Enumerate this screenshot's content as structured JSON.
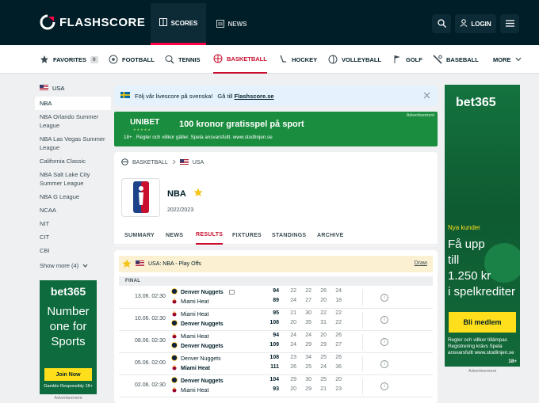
{
  "header": {
    "logo_text": "FLASHSCORE",
    "nav": [
      {
        "label": "SCORES"
      },
      {
        "label": "NEWS"
      }
    ],
    "login_label": "LOGIN"
  },
  "sports": [
    {
      "label": "FAVORITES",
      "count": "0",
      "icon": "star-icon"
    },
    {
      "label": "FOOTBALL",
      "icon": "football-icon"
    },
    {
      "label": "TENNIS",
      "icon": "tennis-icon"
    },
    {
      "label": "BASKETBALL",
      "icon": "basketball-icon",
      "active": true
    },
    {
      "label": "HOCKEY",
      "icon": "hockey-icon"
    },
    {
      "label": "VOLLEYBALL",
      "icon": "volleyball-icon"
    },
    {
      "label": "GOLF",
      "icon": "golf-icon"
    },
    {
      "label": "BASEBALL",
      "icon": "baseball-icon"
    },
    {
      "label": "MORE",
      "icon": "chevron-down-icon"
    }
  ],
  "sidebar": {
    "country": "USA",
    "leagues": [
      "NBA",
      "NBA Orlando Summer League",
      "NBA Las Vegas Summer League",
      "California Classic",
      "NBA Salt Lake City Summer League",
      "NBA G League",
      "NCAA",
      "NIT",
      "CIT",
      "CBI"
    ],
    "show_more": "Show more (4)"
  },
  "ad_left": {
    "brand": "bet365",
    "text": "Number one for Sports",
    "button": "Join Now",
    "gamble": "Gamble Responsibly 18+",
    "caption": "Advertisement"
  },
  "notice": {
    "text": "Följ vår livescore på svenska!",
    "prefix": "Gå till",
    "link": "Flashscore.se"
  },
  "promo": {
    "brand": "UNIBET",
    "stars": "★★★★★",
    "headline": "100 kronor gratisspel på sport",
    "fine": "18+ . Regler och villkor gäller. Spela ansvarsfullt. www.stodlinjen.se",
    "advertisement": "Advertisement"
  },
  "breadcrumb": {
    "sport": "BASKETBALL",
    "country": "USA"
  },
  "competition": {
    "name": "NBA",
    "season": "2022/2023"
  },
  "tabs": [
    "SUMMARY",
    "NEWS",
    "RESULTS",
    "FIXTURES",
    "STANDINGS",
    "ARCHIVE"
  ],
  "active_tab": "RESULTS",
  "league_bar": {
    "label": "USA: NBA - Play Offs",
    "draw": "Draw"
  },
  "status": "FINAL",
  "matches": [
    {
      "date": "13.06. 02:30",
      "home": "Denver Nuggets",
      "away": "Miami Heat",
      "home_total": "94",
      "away_total": "89",
      "home_q": [
        "22",
        "22",
        "26",
        "24"
      ],
      "away_q": [
        "24",
        "27",
        "20",
        "18"
      ],
      "winner": "home"
    },
    {
      "date": "10.06. 02:30",
      "home": "Miami Heat",
      "away": "Denver Nuggets",
      "home_total": "95",
      "away_total": "108",
      "home_q": [
        "21",
        "30",
        "22",
        "22"
      ],
      "away_q": [
        "20",
        "35",
        "31",
        "22"
      ],
      "winner": "away"
    },
    {
      "date": "08.06. 02:30",
      "home": "Miami Heat",
      "away": "Denver Nuggets",
      "home_total": "94",
      "away_total": "109",
      "home_q": [
        "24",
        "24",
        "20",
        "26"
      ],
      "away_q": [
        "24",
        "29",
        "29",
        "27"
      ],
      "winner": "away"
    },
    {
      "date": "05.06. 02:00",
      "home": "Denver Nuggets",
      "away": "Miami Heat",
      "home_total": "108",
      "away_total": "111",
      "home_q": [
        "23",
        "34",
        "25",
        "26"
      ],
      "away_q": [
        "26",
        "25",
        "24",
        "36"
      ],
      "winner": "away"
    },
    {
      "date": "02.06. 02:30",
      "home": "Denver Nuggets",
      "away": "Miami Heat",
      "home_total": "104",
      "away_total": "93",
      "home_q": [
        "29",
        "30",
        "25",
        "20"
      ],
      "away_q": [
        "20",
        "29",
        "21",
        "23"
      ],
      "winner": "home"
    }
  ],
  "ad_right": {
    "brand": "bet365",
    "nya": "Nya kunder",
    "offer": [
      "Få upp",
      "till",
      "1.250 kr",
      "i spelkrediter"
    ],
    "cta": "Bli medlem",
    "terms": "Regler och villkor tillämpas Registrering krävs Spela ansvarsfullt www.stodlinjen.se",
    "age": "18+",
    "caption": "Advertisement"
  },
  "colors": {
    "header_bg": "#001e28",
    "accent": "#ff0046",
    "basketball_active": "#c8102e",
    "bet365_green": "#14733f",
    "bet365_yellow": "#ffdf1b",
    "unibet_green": "#1b8d3f"
  }
}
